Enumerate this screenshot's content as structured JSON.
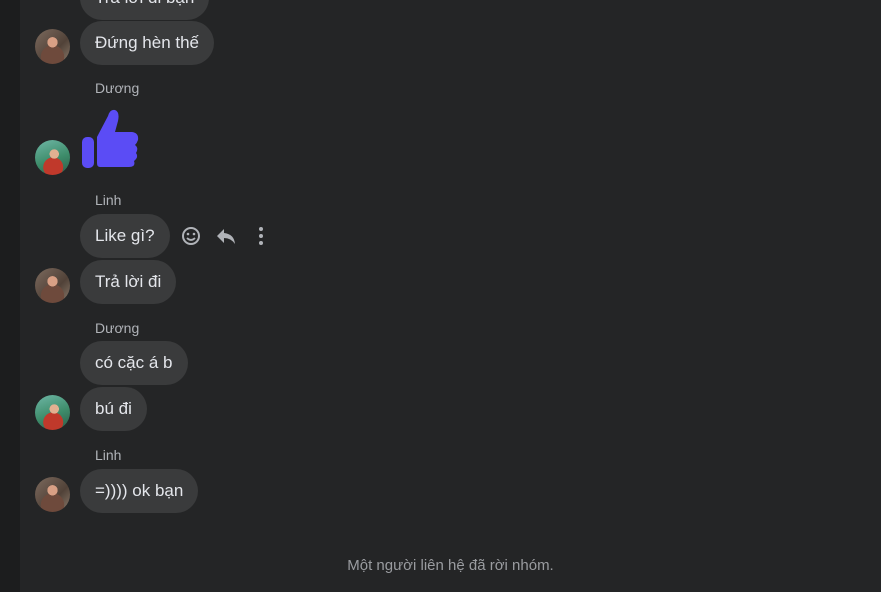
{
  "conversation": {
    "messages": [
      {
        "sender": "",
        "text": "Trả lời đi bạn"
      },
      {
        "sender": "",
        "text": "Đứng hèn thế"
      },
      {
        "sender": "Dương",
        "icon": "thumbs-up-icon"
      },
      {
        "sender": "Linh",
        "text": "Like gì?"
      },
      {
        "sender": "",
        "text": "Trả lời đi"
      },
      {
        "sender": "Dương",
        "text": "có cặc á b"
      },
      {
        "sender": "",
        "text": "bú đi"
      },
      {
        "sender": "Linh",
        "text": "=)))) ok bạn"
      }
    ],
    "system_note": "Một người liên hệ đã rời nhóm."
  },
  "colors": {
    "background": "#242526",
    "bubble": "#3a3b3c",
    "like_accent": "#5b4cf5"
  }
}
